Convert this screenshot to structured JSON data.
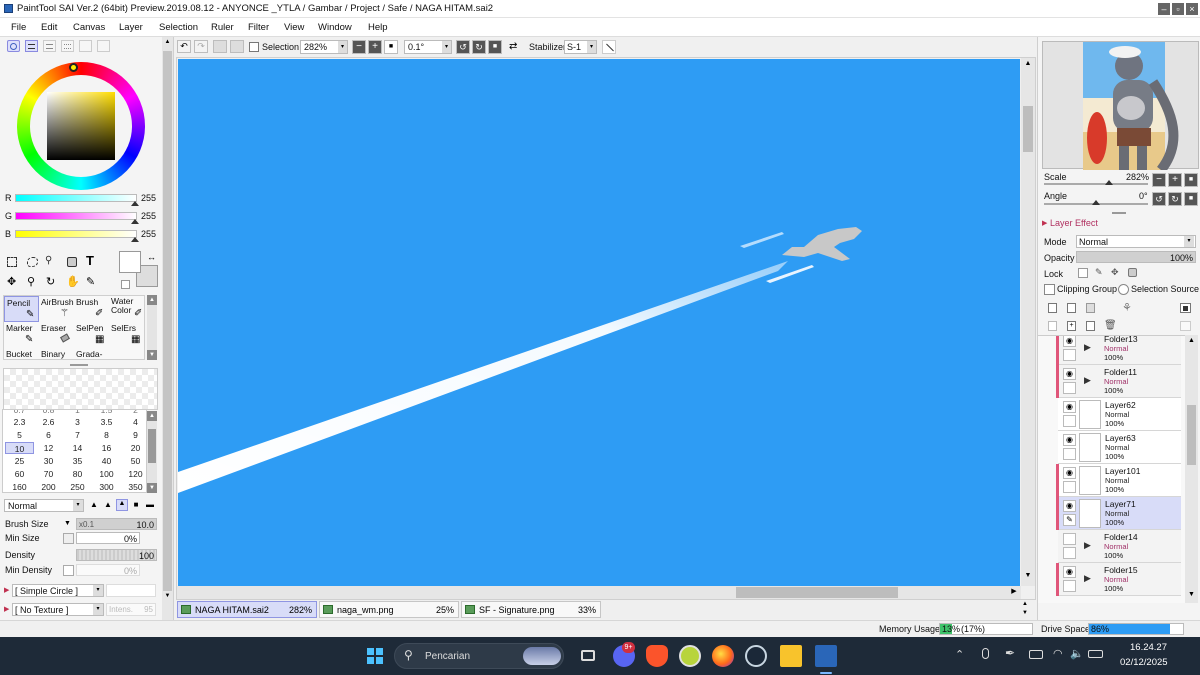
{
  "window": {
    "title": "PaintTool SAI Ver.2 (64bit) Preview.2019.08.12 - ANYONCE _YTLA / Gambar / Project / Safe / NAGA HITAM.sai2"
  },
  "menu": [
    "File",
    "Edit",
    "Canvas",
    "Layer",
    "Selection",
    "Ruler",
    "Filter",
    "View",
    "Window",
    "Help"
  ],
  "toolbar": {
    "selection_label": "Selection",
    "zoom": "282%",
    "angle": "0.1°",
    "stabilizer_label": "Stabilizer",
    "stabilizer": "S-1"
  },
  "color": {
    "r_label": "R",
    "g_label": "G",
    "b_label": "B",
    "r": "255",
    "g": "255",
    "b": "255"
  },
  "tools": [
    {
      "label": "Pencil",
      "selected": true
    },
    {
      "label": "AirBrush"
    },
    {
      "label": "Brush"
    },
    {
      "label": "Water\nColor"
    },
    {
      "label": "Marker"
    },
    {
      "label": "Eraser"
    },
    {
      "label": "SelPen"
    },
    {
      "label": "SelErs"
    },
    {
      "label": "Bucket"
    },
    {
      "label": "Binary"
    },
    {
      "label": "Grada-"
    }
  ],
  "brush_sizes_partial": [
    "0.7",
    "0.8",
    "1",
    "1.5",
    "2"
  ],
  "brush_sizes": [
    "2.3",
    "2.6",
    "3",
    "3.5",
    "4",
    "5",
    "6",
    "7",
    "8",
    "9",
    "10",
    "12",
    "14",
    "16",
    "20",
    "25",
    "30",
    "35",
    "40",
    "50",
    "60",
    "70",
    "80",
    "100",
    "120",
    "160",
    "200",
    "250",
    "300",
    "350"
  ],
  "brush_selected": "10",
  "brush": {
    "blend_mode": "Normal",
    "size_label": "Brush Size",
    "size_mult": "x0.1",
    "size": "10.0",
    "min_size_label": "Min Size",
    "min_size": "0%",
    "density_label": "Density",
    "density": "100",
    "min_density_label": "Min Density",
    "min_density": "0%",
    "shape": "[ Simple Circle ]",
    "texture": "[ No Texture ]",
    "intensity_label": "Intens.",
    "intensity": "95"
  },
  "navigator": {
    "scale_label": "Scale",
    "scale": "282%",
    "angle_label": "Angle",
    "angle": "0°"
  },
  "layer_panel": {
    "effect_label": "Layer Effect",
    "mode_label": "Mode",
    "mode": "Normal",
    "opacity_label": "Opacity",
    "opacity": "100%",
    "lock_label": "Lock",
    "clipping": "Clipping Group",
    "selection_source": "Selection Source"
  },
  "layers": [
    {
      "name": "Folder13",
      "mode": "Normal",
      "opacity": "100%",
      "folder": true,
      "tag": true,
      "visible": true
    },
    {
      "name": "Folder11",
      "mode": "Normal",
      "opacity": "100%",
      "folder": true,
      "tag": true,
      "visible": true
    },
    {
      "name": "Layer62",
      "mode": "Normal",
      "opacity": "100%",
      "visible": true
    },
    {
      "name": "Layer63",
      "mode": "Normal",
      "opacity": "100%",
      "visible": true
    },
    {
      "name": "Layer101",
      "mode": "Normal",
      "opacity": "100%",
      "tag": true,
      "visible": true
    },
    {
      "name": "Layer71",
      "mode": "Normal",
      "opacity": "100%",
      "tag": true,
      "selected": true,
      "visible": true
    },
    {
      "name": "Folder14",
      "mode": "Normal",
      "opacity": "100%",
      "folder": true,
      "visible": false
    },
    {
      "name": "Folder15",
      "mode": "Normal",
      "opacity": "100%",
      "folder": true,
      "tag": true,
      "visible": true
    }
  ],
  "tabs": [
    {
      "name": "NAGA HITAM.sai2",
      "zoom": "282%",
      "active": true
    },
    {
      "name": "naga_wm.png",
      "zoom": "25%"
    },
    {
      "name": "SF - Signature.png",
      "zoom": "33%"
    }
  ],
  "status": {
    "memory_label": "Memory Usage",
    "memory_pct": "13%",
    "memory_paren": "(17%)",
    "memory_fraction": 0.13,
    "drive_label": "Drive Space",
    "drive_pct": "86%",
    "drive_fraction": 0.86
  },
  "taskbar": {
    "search_placeholder": "Pencarian",
    "time": "16.24.27",
    "date": "02/12/2025",
    "badge": "9+"
  },
  "colors": {
    "canvas": "#2e9cf4",
    "accent": "#e0567a",
    "selection": "#d8dcf8"
  }
}
